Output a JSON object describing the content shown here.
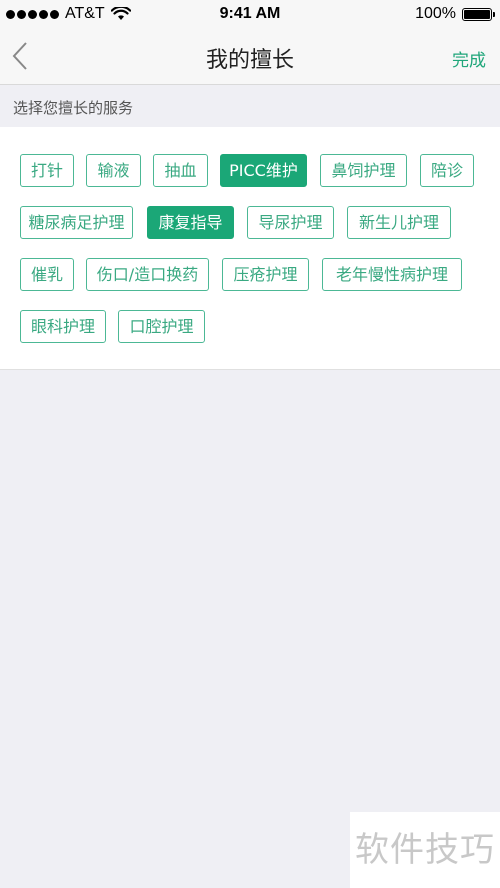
{
  "status_bar": {
    "carrier": "AT&T",
    "time": "9:41 AM",
    "battery": "100%"
  },
  "nav": {
    "title": "我的擅长",
    "done_label": "完成"
  },
  "section": {
    "header": "选择您擅长的服务"
  },
  "tags": [
    {
      "label": "打针",
      "selected": false
    },
    {
      "label": "输液",
      "selected": false
    },
    {
      "label": "抽血",
      "selected": false
    },
    {
      "label": "PICC维护",
      "selected": true
    },
    {
      "label": "鼻饲护理",
      "selected": false
    },
    {
      "label": "陪诊",
      "selected": false
    },
    {
      "label": "糖尿病足护理",
      "selected": false
    },
    {
      "label": "康复指导",
      "selected": true
    },
    {
      "label": "导尿护理",
      "selected": false
    },
    {
      "label": "新生儿护理",
      "selected": false
    },
    {
      "label": "催乳",
      "selected": false
    },
    {
      "label": "伤口/造口换药",
      "selected": false
    },
    {
      "label": "压疮护理",
      "selected": false
    },
    {
      "label": "老年慢性病护理",
      "selected": false
    },
    {
      "label": "眼科护理",
      "selected": false
    },
    {
      "label": "口腔护理",
      "selected": false
    }
  ],
  "colors": {
    "accent": "#1ba777",
    "tag_border": "#4cb895",
    "background": "#efeff4"
  },
  "watermark": "软件技巧"
}
